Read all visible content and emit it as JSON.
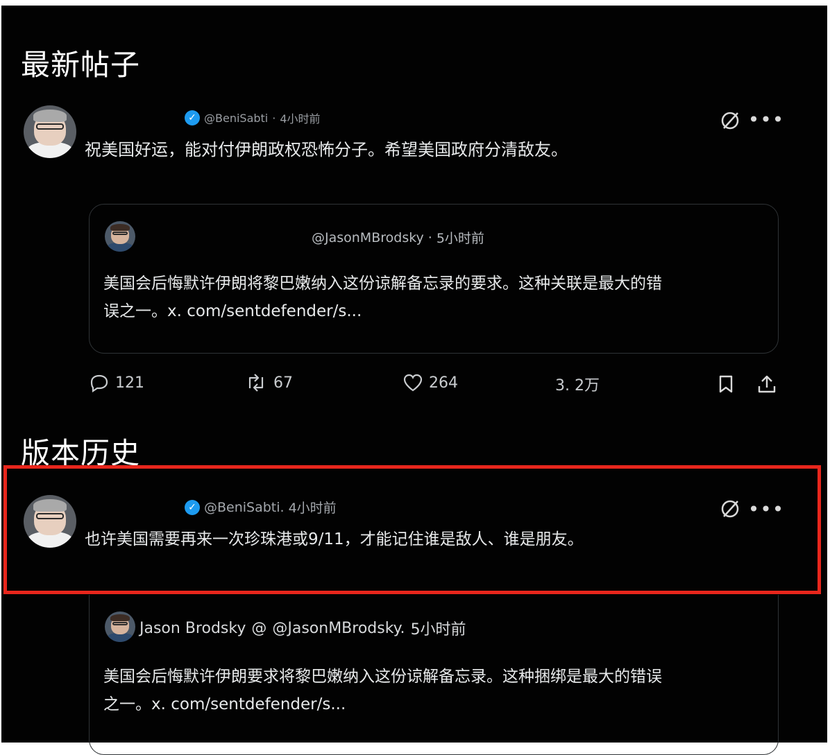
{
  "sections": {
    "latest_title": "最新帖子",
    "history_title": "版本历史"
  },
  "latest_post": {
    "handle": "@BeniSabti",
    "separator": "·",
    "time": "4小时前",
    "text": "祝美国好运，能对付伊朗政权恐怖分子。希望美国政府分清敌友。",
    "quote": {
      "handle": "@JasonMBrodsky",
      "separator": "·",
      "time": "5小时前",
      "text_line1": "美国会后悔默许伊朗将黎巴嫩纳入这份谅解备忘录的要求。这种关联是最大的错",
      "text_line2": "误之一。x. com/sentdefender/s..."
    },
    "stats": {
      "replies": "121",
      "retweets": "67",
      "likes": "264",
      "views": "3. 2万"
    }
  },
  "history_post": {
    "handle": "@BeniSabti.",
    "time": "4小时前",
    "text": "也许美国需要再来一次珍珠港或9/11，才能记住谁是敌人、谁是朋友。",
    "quote": {
      "name": "Jason Brodsky",
      "at_sign": "@",
      "handle": "@JasonMBrodsky.",
      "time": "5小时前",
      "text_line1": "美国会后悔默许伊朗要求将黎巴嫩纳入这份谅解备忘录。这种捆绑是最大的错误",
      "text_line2": "之一。x. com/sentdefender/s..."
    }
  },
  "icons": {
    "grok": "grok-icon",
    "more": "more-icon",
    "reply": "reply-icon",
    "retweet": "retweet-icon",
    "like": "heart-icon",
    "bookmark": "bookmark-icon",
    "share": "share-icon",
    "verified": "verified-badge-icon"
  },
  "colors": {
    "background": "#020202",
    "text": "#e7e9ea",
    "muted": "#9a9ea3",
    "verified": "#1d9bf0",
    "highlight": "#e8261c"
  }
}
